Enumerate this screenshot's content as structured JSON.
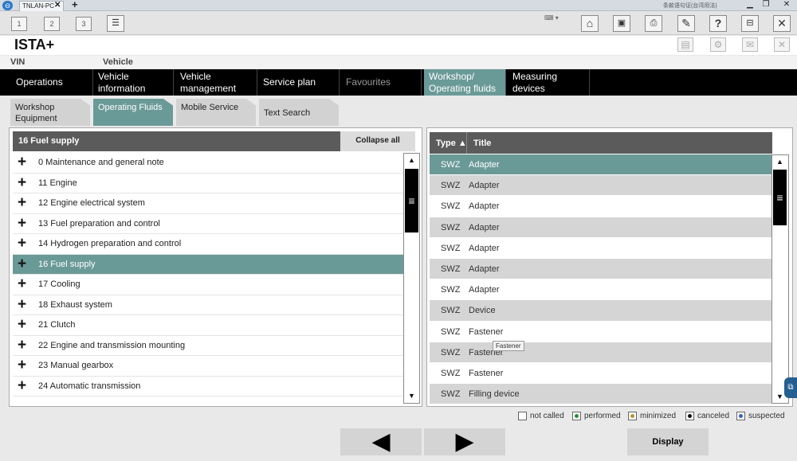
{
  "browser": {
    "tab_label": "TNLAN-PC",
    "tab_close": "✕",
    "new_tab": "+",
    "system_text": "条款语句证(台湾用法)"
  },
  "toolbar": {
    "session_buttons": [
      "1",
      "2",
      "3"
    ],
    "icons": [
      "list-icon",
      "home-icon",
      "vehicle-info-icon",
      "print-icon",
      "wrench-icon",
      "help-icon",
      "minimize-window-icon",
      "close-icon"
    ]
  },
  "app": {
    "title": "ISTA+",
    "secondary_icons": [
      "document-icon",
      "gear-icon",
      "mail-icon",
      "close-icon"
    ]
  },
  "vehicle_row": {
    "vin_label": "VIN",
    "vehicle_label": "Vehicle"
  },
  "nav": {
    "tabs": [
      {
        "label": "Operations",
        "state": "normal"
      },
      {
        "label": "Vehicle information",
        "state": "normal"
      },
      {
        "label": "Vehicle management",
        "state": "normal"
      },
      {
        "label": "Service plan",
        "state": "normal"
      },
      {
        "label": "Favourites",
        "state": "dim"
      },
      {
        "label": "Workshop/ Operating fluids",
        "state": "active"
      },
      {
        "label": "Measuring devices",
        "state": "normal"
      }
    ]
  },
  "subnav": {
    "tabs": [
      {
        "label": "Workshop Equipment",
        "active": false
      },
      {
        "label": "Operating Fluids",
        "active": true
      },
      {
        "label": "Mobile Service",
        "active": false
      },
      {
        "label": "Text Search",
        "active": false
      }
    ]
  },
  "left_panel": {
    "header": "16 Fuel supply",
    "collapse_label": "Collapse all",
    "items": [
      {
        "label": "0 Maintenance and general note",
        "selected": false
      },
      {
        "label": "11 Engine",
        "selected": false
      },
      {
        "label": "12 Engine electrical system",
        "selected": false
      },
      {
        "label": "13 Fuel preparation and control",
        "selected": false
      },
      {
        "label": "14 Hydrogen preparation and control",
        "selected": false
      },
      {
        "label": "16 Fuel supply",
        "selected": true
      },
      {
        "label": "17 Cooling",
        "selected": false
      },
      {
        "label": "18 Exhaust system",
        "selected": false
      },
      {
        "label": "21 Clutch",
        "selected": false
      },
      {
        "label": "22 Engine and transmission mounting",
        "selected": false
      },
      {
        "label": "23 Manual gearbox",
        "selected": false
      },
      {
        "label": "24 Automatic transmission",
        "selected": false
      }
    ],
    "expand_glyph": "+"
  },
  "right_panel": {
    "col_type": "Type ▲",
    "col_title": "Title",
    "rows": [
      {
        "type": "SWZ",
        "title": "Adapter",
        "selected": true
      },
      {
        "type": "SWZ",
        "title": "Adapter",
        "selected": false
      },
      {
        "type": "SWZ",
        "title": "Adapter",
        "selected": false
      },
      {
        "type": "SWZ",
        "title": "Adapter",
        "selected": false
      },
      {
        "type": "SWZ",
        "title": "Adapter",
        "selected": false
      },
      {
        "type": "SWZ",
        "title": "Adapter",
        "selected": false
      },
      {
        "type": "SWZ",
        "title": "Adapter",
        "selected": false
      },
      {
        "type": "SWZ",
        "title": "Device",
        "selected": false
      },
      {
        "type": "SWZ",
        "title": "Fastener",
        "selected": false
      },
      {
        "type": "SWZ",
        "title": "Fastener",
        "selected": false
      },
      {
        "type": "SWZ",
        "title": "Fastener",
        "selected": false
      },
      {
        "type": "SWZ",
        "title": "Filling device",
        "selected": false
      }
    ],
    "tooltip": "Fastener"
  },
  "legend": [
    {
      "label": "not called",
      "color": "#ffffff"
    },
    {
      "label": "performed",
      "color": "#2e8b3a"
    },
    {
      "label": "minimized",
      "color": "#b8962e"
    },
    {
      "label": "canceled",
      "color": "#111111"
    },
    {
      "label": "suspected",
      "color": "#3a5fbf"
    }
  ],
  "bottom": {
    "back_glyph": "◀",
    "forward_glyph": "▶",
    "display_label": "Display"
  },
  "colors": {
    "accent": "#6a9a98",
    "nav_bg": "#000000",
    "header_bg": "#5b5b5b"
  }
}
